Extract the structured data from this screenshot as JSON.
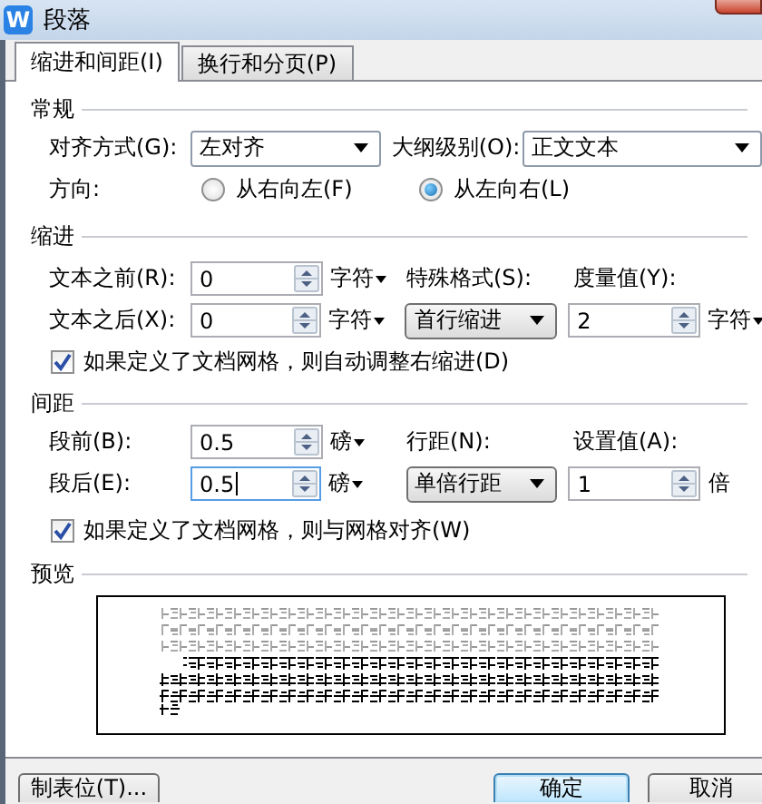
{
  "window": {
    "icon_text": "W",
    "title": "段落"
  },
  "tabs": [
    {
      "label": "缩进和间距(I)",
      "selected": true
    },
    {
      "label": "换行和分页(P)",
      "selected": false
    }
  ],
  "general": {
    "heading": "常规",
    "alignment": {
      "label": "对齐方式(G):",
      "value": "左对齐",
      "kind": "combo"
    },
    "outline_level": {
      "label": "大纲级别(O):",
      "value": "正文文本",
      "kind": "combo"
    },
    "direction": {
      "label": "方向:",
      "options": [
        {
          "label": "从右向左(F)",
          "selected": false
        },
        {
          "label": "从左向右(L)",
          "selected": true
        }
      ]
    }
  },
  "indent": {
    "heading": "缩进",
    "before": {
      "label": "文本之前(R):",
      "value": "0",
      "unit": "字符",
      "unit_dropdown": true,
      "focused": false
    },
    "special_label": "特殊格式(S):",
    "measure_label": "度量值(Y):",
    "after": {
      "label": "文本之后(X):",
      "value": "0",
      "unit": "字符",
      "unit_dropdown": true,
      "focused": false
    },
    "special": {
      "value": "首行缩进",
      "kind": "button"
    },
    "measure": {
      "value": "2",
      "unit": "字符",
      "unit_dropdown": true,
      "focused": false
    },
    "auto_adjust": {
      "label": "如果定义了文档网格，则自动调整右缩进(D)",
      "checked": true
    }
  },
  "spacing": {
    "heading": "间距",
    "before": {
      "label": "段前(B):",
      "value": "0.5",
      "unit": "磅",
      "unit_dropdown": true,
      "focused": false
    },
    "line_label": "行距(N):",
    "setting_label": "设置值(A):",
    "after": {
      "label": "段后(E):",
      "value": "0.5",
      "unit": "磅",
      "unit_dropdown": true,
      "focused": true
    },
    "line_spacing": {
      "value": "单倍行距",
      "kind": "button"
    },
    "setting": {
      "value": "1",
      "unit": "倍",
      "unit_dropdown": false,
      "focused": false
    },
    "snap_to_grid": {
      "label": "如果定义了文档网格，则与网格对齐(W)",
      "checked": true
    }
  },
  "preview": {
    "heading": "预览"
  },
  "buttons": [
    {
      "label": "制表位(T)...",
      "kind": "normal"
    },
    {
      "label": "确定",
      "kind": "default"
    },
    {
      "label": "取消",
      "kind": "normal"
    }
  ]
}
